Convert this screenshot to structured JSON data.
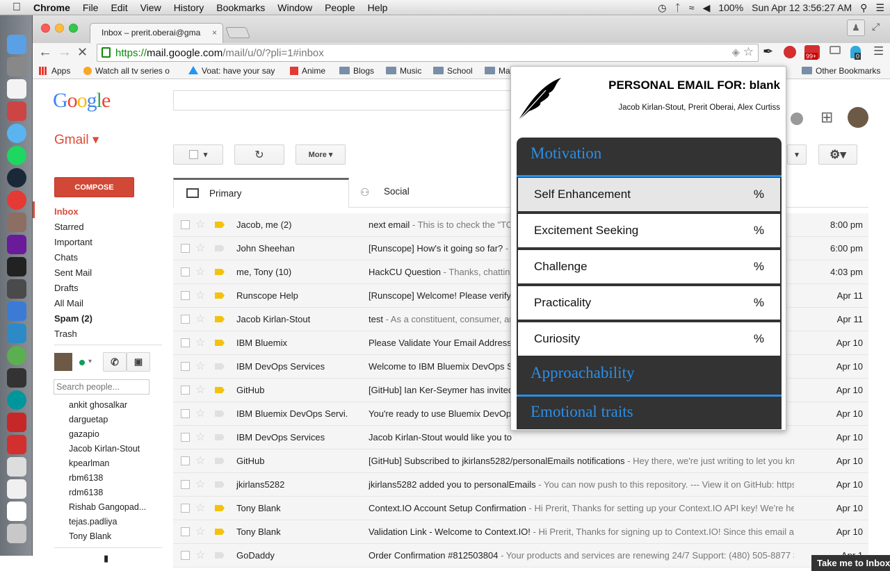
{
  "menubar": {
    "app": "Chrome",
    "items": [
      "File",
      "Edit",
      "View",
      "History",
      "Bookmarks",
      "Window",
      "People",
      "Help"
    ],
    "battery": "100%",
    "clock": "Sun Apr 12  3:56:27 AM"
  },
  "browser": {
    "tab_title": "Inbox – prerit.oberai@gma",
    "url_scheme": "https://",
    "url_host": "mail.google.com",
    "url_path": "/mail/u/0/?pli=1#inbox",
    "badge_1": "99+",
    "badge_2": "0"
  },
  "bookmarks": {
    "items": [
      "Apps",
      "Watch all tv series o",
      "Voat: have your say",
      "Anime",
      "Blogs",
      "Music",
      "School",
      "Ma"
    ],
    "other": "Other Bookmarks"
  },
  "gmail": {
    "logo": "Google",
    "label": "Gmail ▾",
    "compose": "COMPOSE",
    "more": "More ▾",
    "nav": [
      "Inbox",
      "Starred",
      "Important",
      "Chats",
      "Sent Mail",
      "Drafts",
      "All Mail",
      "Spam (2)",
      "Trash"
    ],
    "search_people_placeholder": "Search people...",
    "contacts": [
      "ankit ghosalkar",
      "darguetap",
      "gazapio",
      "Jacob Kirlan-Stout",
      "kpearlman",
      "rbm6138",
      "rdm6138",
      "Rishab Gangopad...",
      "tejas.padliya",
      "Tony Blank"
    ],
    "tabs": {
      "primary": "Primary",
      "social": "Social"
    },
    "emails": [
      {
        "from": "Jacob, me (2)",
        "subject": "next email",
        "snippet": " - This is to check the \"TO",
        "date": "8:00 pm",
        "important": true
      },
      {
        "from": "John Sheehan",
        "subject": "[Runscope] How's it going so far?",
        "snippet": " - I",
        "date": "6:00 pm",
        "important": false
      },
      {
        "from": "me, Tony (10)",
        "subject": "HackCU Question",
        "snippet": " - Thanks, chatting",
        "date": "4:03 pm",
        "important": true
      },
      {
        "from": "Runscope Help",
        "subject": "[Runscope] Welcome! Please verify",
        "snippet": "",
        "date": "Apr 11",
        "important": true
      },
      {
        "from": "Jacob Kirlan-Stout",
        "subject": "test",
        "snippet": " - As a constituent, consumer, an",
        "date": "Apr 11",
        "important": true
      },
      {
        "from": "IBM Bluemix",
        "subject": "Please Validate Your Email Address",
        "snippet": "",
        "date": "Apr 10",
        "important": true
      },
      {
        "from": "IBM DevOps Services",
        "subject": "Welcome to IBM Bluemix DevOps S",
        "snippet": "",
        "date": "Apr 10",
        "important": false
      },
      {
        "from": "GitHub",
        "subject": "[GitHub] Ian Ker-Seymer has invited",
        "snippet": "",
        "date": "Apr 10",
        "important": true
      },
      {
        "from": "IBM Bluemix DevOps Servi.",
        "subject": "You're ready to use Bluemix DevOp",
        "snippet": "",
        "date": "Apr 10",
        "important": false
      },
      {
        "from": "IBM DevOps Services",
        "subject": "Jacob Kirlan-Stout would like you to",
        "snippet": "",
        "date": "Apr 10",
        "important": false
      },
      {
        "from": "GitHub",
        "subject": "[GitHub] Subscribed to jkirlans5282/personalEmails notifications",
        "snippet": " - Hey there, we're just writing to let you know",
        "date": "Apr 10",
        "important": false
      },
      {
        "from": "jkirlans5282",
        "subject": "jkirlans5282 added you to personalEmails",
        "snippet": " - You can now push to this repository. --- View it on GitHub: https:/",
        "date": "Apr 10",
        "important": false
      },
      {
        "from": "Tony Blank",
        "subject": "Context.IO Account Setup Confirmation",
        "snippet": " - Hi Prerit, Thanks for setting up your Context.IO API key! We're here",
        "date": "Apr 10",
        "important": true
      },
      {
        "from": "Tony Blank",
        "subject": "Validation Link - Welcome to Context.IO!",
        "snippet": " - Hi Prerit, Thanks for signing up to Context.IO! Since this email add",
        "date": "Apr 10",
        "important": true
      },
      {
        "from": "GoDaddy",
        "subject": "Order Confirmation #812503804",
        "snippet": " - Your products and services are renewing 24/7 Support: (480) 505-8877 Se",
        "date": "Apr 1",
        "important": false
      }
    ],
    "toast": "Take me to Inbox"
  },
  "popup": {
    "title": "PERSONAL EMAIL FOR: blank",
    "authors": "Jacob Kirlan-Stout, Prerit Oberai, Alex Curtiss",
    "section_1": "Motivation",
    "traits": [
      {
        "name": "Self Enhancement",
        "value": "%"
      },
      {
        "name": "Excitement Seeking",
        "value": "%"
      },
      {
        "name": "Challenge",
        "value": "%"
      },
      {
        "name": "Practicality",
        "value": "%"
      },
      {
        "name": "Curiosity",
        "value": "%"
      }
    ],
    "section_2": "Approachability",
    "section_3": "Emotional traits"
  },
  "colors": {
    "gmail_red": "#dd4b39",
    "compose": "#d14836",
    "popup_accent": "#2b8fe8",
    "panel": "#333333",
    "important": "#f4c20d"
  }
}
